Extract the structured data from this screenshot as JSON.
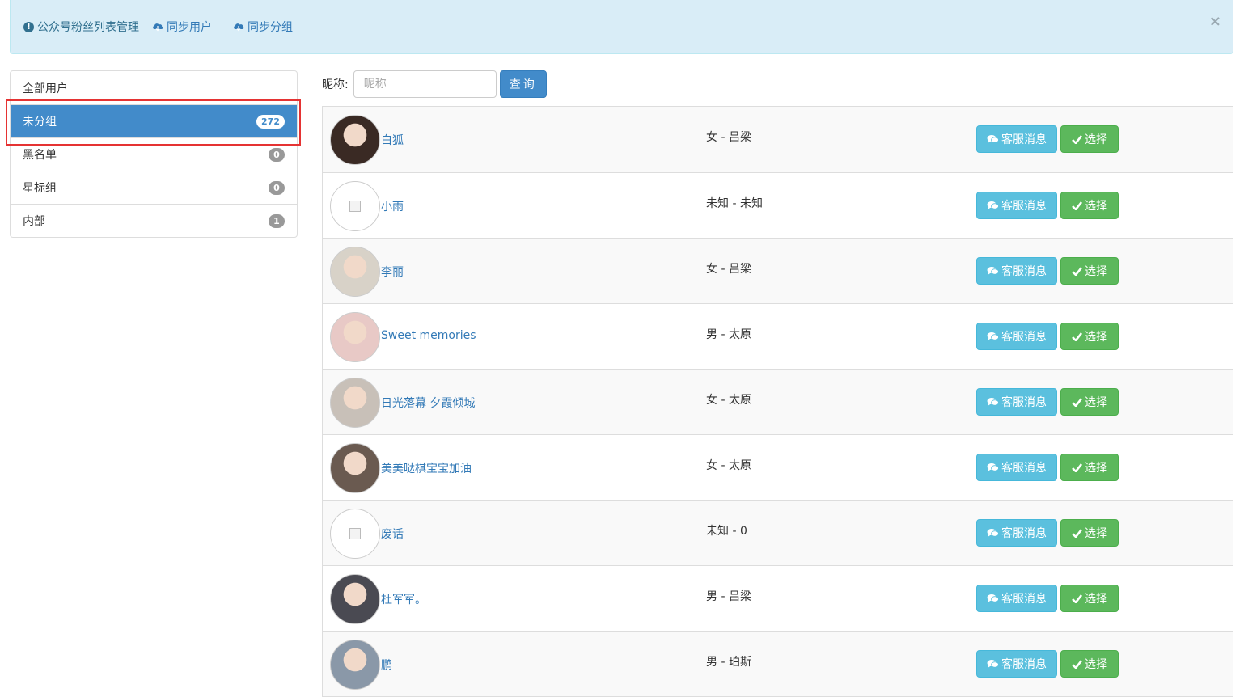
{
  "alert": {
    "title": "公众号粉丝列表管理",
    "sync_users": "同步用户",
    "sync_groups": "同步分组",
    "close": "×"
  },
  "groups": [
    {
      "label": "全部用户",
      "count": null
    },
    {
      "label": "未分组",
      "count": "272",
      "active": true
    },
    {
      "label": "黑名单",
      "count": "0"
    },
    {
      "label": "星标组",
      "count": "0"
    },
    {
      "label": "内部",
      "count": "1"
    }
  ],
  "search": {
    "label": "昵称:",
    "placeholder": "昵称",
    "button": "查询"
  },
  "actions": {
    "message": "客服消息",
    "select": "选择"
  },
  "users": [
    {
      "nick": "白狐",
      "info": "女 - 吕梁",
      "avatar": "photo"
    },
    {
      "nick": "小雨",
      "info": "未知 - 未知",
      "avatar": "broken"
    },
    {
      "nick": "李丽",
      "info": "女 - 吕梁",
      "avatar": "photo"
    },
    {
      "nick": "Sweet memories",
      "info": "男 - 太原",
      "avatar": "photo"
    },
    {
      "nick": "日光落幕 夕霞倾城",
      "info": "女 - 太原",
      "avatar": "photo"
    },
    {
      "nick": "美美哒棋宝宝加油",
      "info": "女 - 太原",
      "avatar": "photo"
    },
    {
      "nick": "废话",
      "info": "未知 - 0",
      "avatar": "broken"
    },
    {
      "nick": "杜军军。",
      "info": "男 - 吕梁",
      "avatar": "photo"
    },
    {
      "nick": "鹏",
      "info": "男 - 珀斯",
      "avatar": "photo"
    }
  ]
}
